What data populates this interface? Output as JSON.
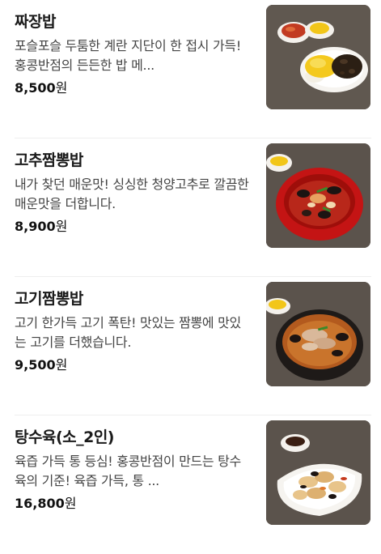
{
  "menu": {
    "items": [
      {
        "name": "짜장밥",
        "description": "포슬포슬 두툼한 계란 지단이 한 접시 가득! 홍콩반점의 든든한 밥 메...",
        "price": "8,500",
        "currency": "원",
        "photo_icon": "jjajang-rice-photo"
      },
      {
        "name": "고추짬뽕밥",
        "description": "내가 찾던 매운맛! 싱싱한 청양고추로 깔끔한 매운맛을 더합니다.",
        "price": "8,900",
        "currency": "원",
        "photo_icon": "gochu-jjamppong-rice-photo"
      },
      {
        "name": "고기짬뽕밥",
        "description": "고기 한가득 고기 폭탄! 맛있는 짬뽕에 맛있는 고기를 더했습니다.",
        "price": "9,500",
        "currency": "원",
        "photo_icon": "gogi-jjamppong-rice-photo"
      },
      {
        "name": "탕수육(소_2인)",
        "description": "육즙 가득 통 등심! 홍콩반점이 만드는 탕수육의 기준! 육즙 가득, 통 ...",
        "price": "16,800",
        "currency": "원",
        "photo_icon": "tangsuyuk-photo"
      }
    ]
  }
}
